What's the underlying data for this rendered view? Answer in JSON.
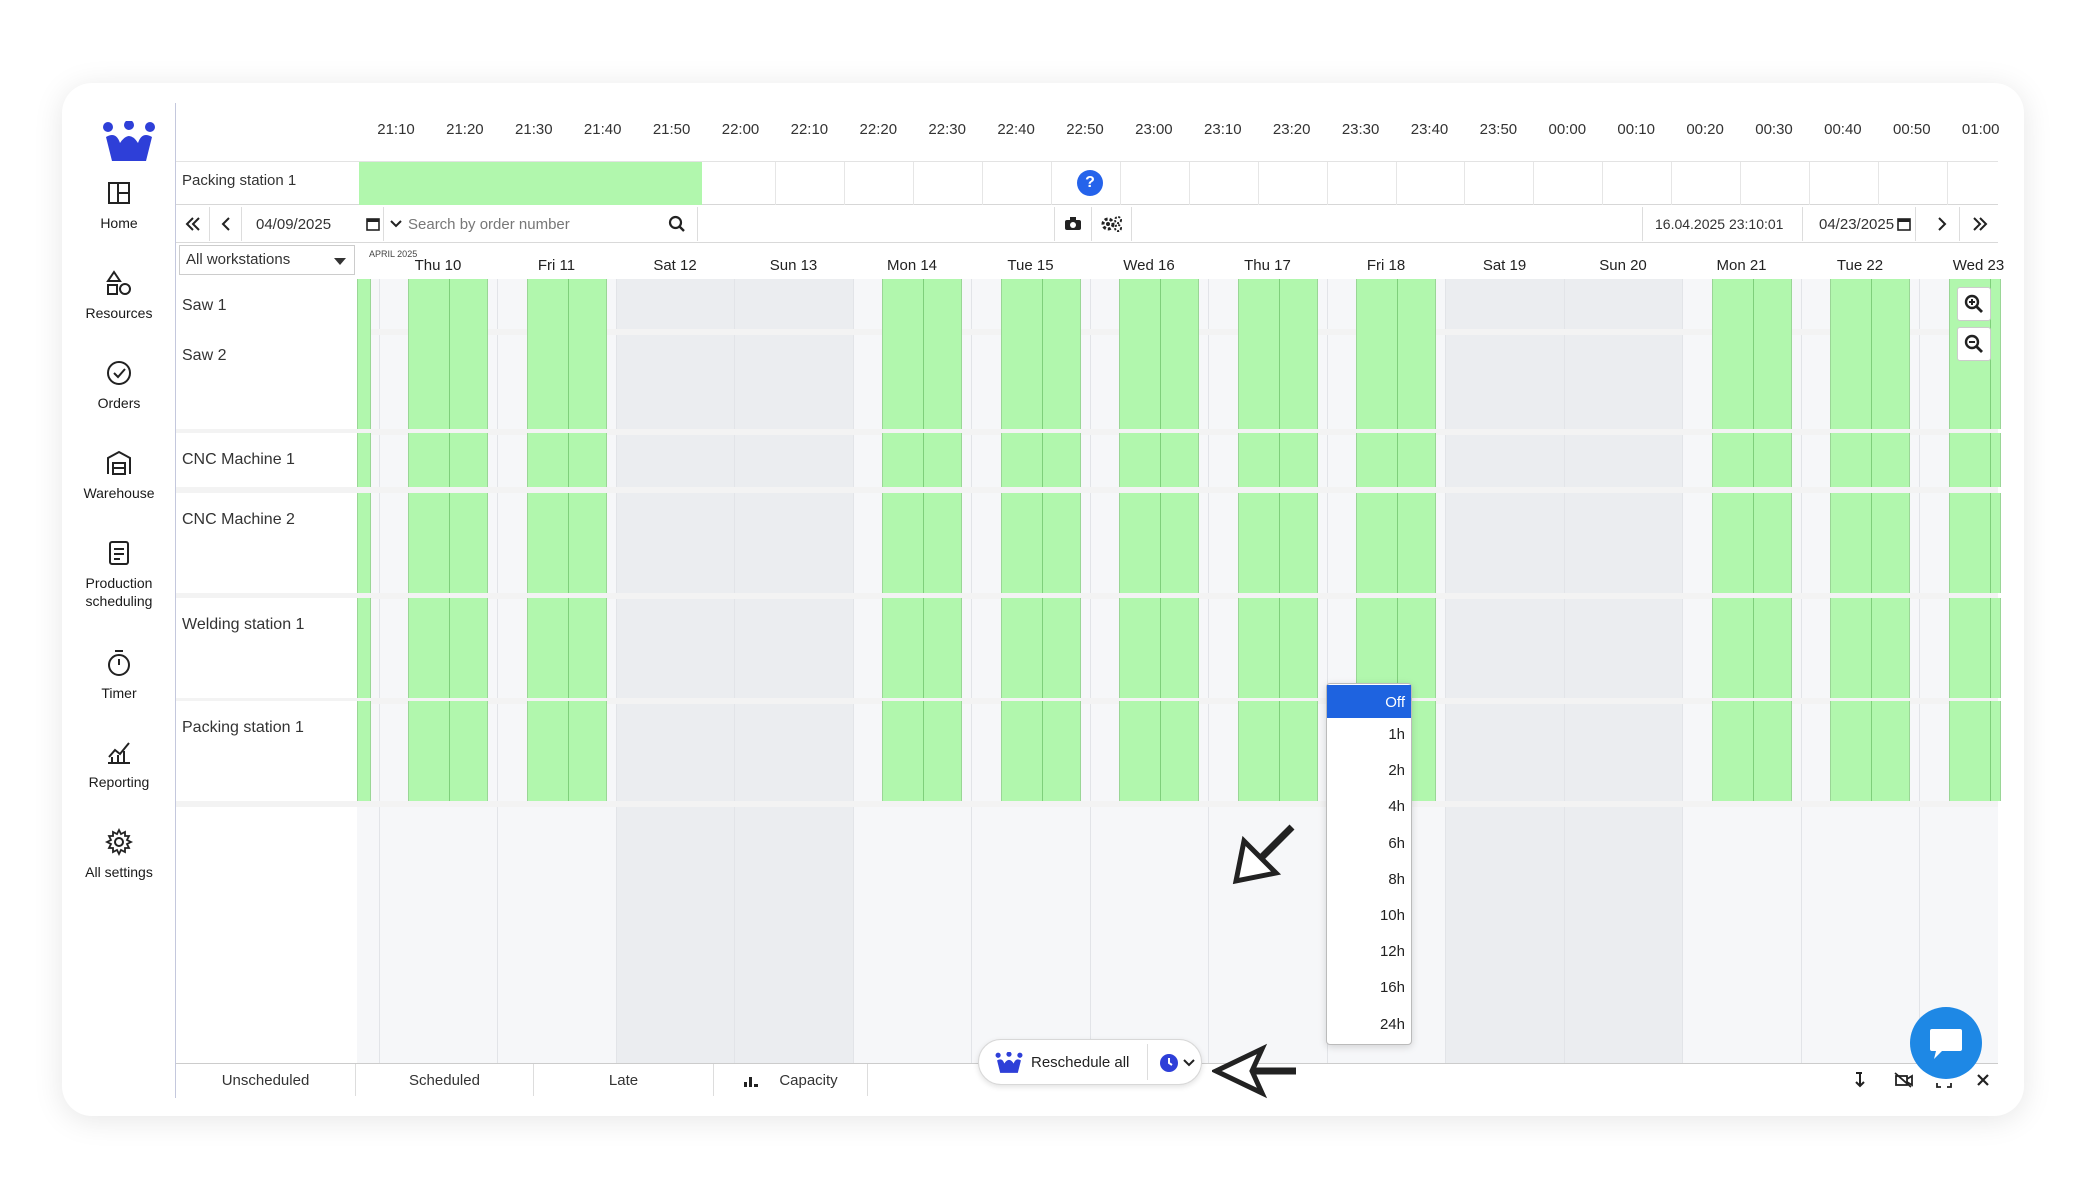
{
  "sidebar": {
    "items": [
      {
        "label": "Home",
        "icon": "layout-icon"
      },
      {
        "label": "Resources",
        "icon": "shapes-icon"
      },
      {
        "label": "Orders",
        "icon": "check-circle-icon"
      },
      {
        "label": "Warehouse",
        "icon": "warehouse-icon"
      },
      {
        "label": "Production scheduling",
        "icon": "schedule-icon",
        "active": true
      },
      {
        "label": "Timer",
        "icon": "stopwatch-icon"
      },
      {
        "label": "Reporting",
        "icon": "chart-icon"
      },
      {
        "label": "All settings",
        "icon": "gear-icon"
      }
    ]
  },
  "timeline": {
    "ticks": [
      "21:10",
      "21:20",
      "21:30",
      "21:40",
      "21:50",
      "22:00",
      "22:10",
      "22:20",
      "22:30",
      "22:40",
      "22:50",
      "23:00",
      "23:10",
      "23:20",
      "23:30",
      "23:40",
      "23:50",
      "00:00",
      "00:10",
      "00:20",
      "00:30",
      "00:40",
      "00:50",
      "01:00"
    ],
    "row_label": "Packing station 1",
    "help": "?"
  },
  "toolbar": {
    "start_date": "04/09/2025",
    "search_placeholder": "Search by order number",
    "current_datetime": "16.04.2025 23:10:01",
    "end_date": "04/23/2025"
  },
  "gantt": {
    "workstation_filter": "All workstations",
    "month": "APRIL 2025",
    "days": [
      "Thu 10",
      "Fri 11",
      "Sat 12",
      "Sun 13",
      "Mon 14",
      "Tue 15",
      "Wed 16",
      "Thu 17",
      "Fri 18",
      "Sat 19",
      "Sun 20",
      "Mon 21",
      "Tue 22",
      "Wed 23"
    ],
    "rows": [
      "Saw 1",
      "Saw 2",
      "CNC Machine 1",
      "CNC Machine 2",
      "Welding station 1",
      "Packing station 1"
    ]
  },
  "dropdown": {
    "options": [
      "Off",
      "1h",
      "2h",
      "4h",
      "6h",
      "8h",
      "10h",
      "12h",
      "16h",
      "24h"
    ],
    "selected": "Off"
  },
  "reschedule": {
    "label": "Reschedule all"
  },
  "bottom_tabs": [
    "Unscheduled",
    "Scheduled",
    "Late",
    "Capacity"
  ],
  "colors": {
    "accent": "#2563eb",
    "available": "#b1f7ad",
    "weekend": "#ebedf0"
  }
}
